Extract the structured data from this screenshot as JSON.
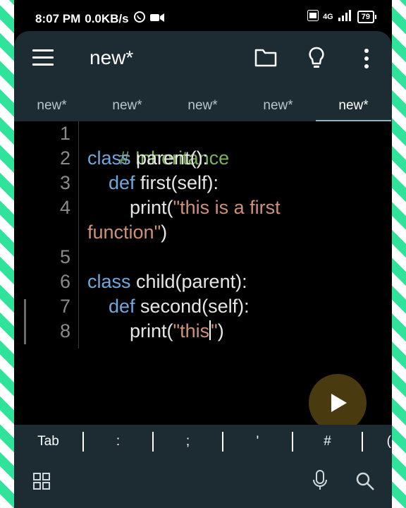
{
  "status": {
    "time": "8:07 PM",
    "speed": "0.0KB/s",
    "network": "4G",
    "battery": "79"
  },
  "appbar": {
    "title": "new*"
  },
  "tabs": [
    {
      "label": "new*"
    },
    {
      "label": "new*"
    },
    {
      "label": "new*"
    },
    {
      "label": "new*"
    },
    {
      "label": "new*"
    }
  ],
  "editor": {
    "line_numbers": [
      "1",
      "2",
      "3",
      "4",
      "5",
      "6",
      "7",
      "8"
    ],
    "code": {
      "l1": "# Inheritance",
      "l2_kw": "class",
      "l2_rest": " parent():",
      "l3_kw": "def",
      "l3_rest": " first(self):",
      "l4_a": "print(",
      "l4_str": "\"this is a first",
      "l4b_str": "function\"",
      "l4b_rest": ")",
      "l6_kw": "class",
      "l6_rest": " child(parent):",
      "l7_kw": "def",
      "l7_rest": " second(self):",
      "l8_a": "print(",
      "l8_str": "\"this",
      "l8_str2": "\"",
      "l8_rest": ")"
    }
  },
  "keys": [
    "Tab",
    ":",
    ";",
    "'",
    "#",
    "("
  ],
  "colors": {
    "accent_green": "#2fe39a",
    "toolbar": "#1d2c33",
    "keyword": "#6fa8dc",
    "string": "#ce9178",
    "comment": "#7cb35a"
  }
}
